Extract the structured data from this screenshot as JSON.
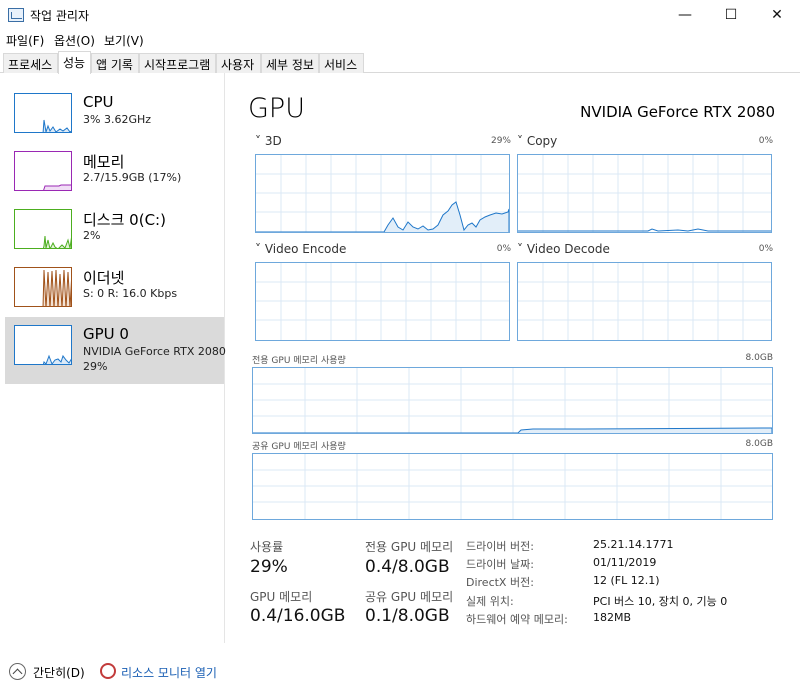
{
  "window": {
    "title": "작업 관리자",
    "controls": [
      "—",
      "☐",
      "✕"
    ]
  },
  "menu": [
    "파일(F)",
    "옵션(O)",
    "보기(V)"
  ],
  "tabs": [
    "프로세스",
    "성능",
    "앱 기록",
    "시작프로그램",
    "사용자",
    "세부 정보",
    "서비스"
  ],
  "active_tab": "성능",
  "sidebar": [
    {
      "title": "CPU",
      "sub1": "3% 3.62GHz",
      "sub2": "",
      "color": "#1f77c9"
    },
    {
      "title": "메모리",
      "sub1": "2.7/15.9GB (17%)",
      "sub2": "",
      "color": "#9a28b4"
    },
    {
      "title": "디스크 0(C:)",
      "sub1": "2%",
      "sub2": "",
      "color": "#4cae1f"
    },
    {
      "title": "이더넷",
      "sub1": "S: 0 R: 16.0 Kbps",
      "sub2": "",
      "color": "#a0521a"
    },
    {
      "title": "GPU 0",
      "sub1": "NVIDIA GeForce RTX 2080",
      "sub2": "29%",
      "color": "#1f77c9"
    }
  ],
  "main": {
    "title": "GPU",
    "device_name": "NVIDIA GeForce RTX 2080",
    "engines": [
      {
        "label": "3D",
        "pct": "29%"
      },
      {
        "label": "Copy",
        "pct": "0%"
      },
      {
        "label": "Video Encode",
        "pct": "0%"
      },
      {
        "label": "Video Decode",
        "pct": "0%"
      }
    ],
    "dedicated_label": "전용 GPU 메모리 사용량",
    "dedicated_max": "8.0GB",
    "shared_label": "공유 GPU 메모리 사용량",
    "shared_max": "8.0GB",
    "stats": {
      "usage_label": "사용률",
      "usage_value": "29%",
      "dedicated_label": "전용 GPU 메모리",
      "dedicated_value": "0.4/8.0GB",
      "gpu_mem_label": "GPU 메모리",
      "gpu_mem_value": "0.4/16.0GB",
      "shared_label": "공유 GPU 메모리",
      "shared_value": "0.1/8.0GB"
    },
    "info": [
      {
        "label": "드라이버 버전:",
        "value": "25.21.14.1771"
      },
      {
        "label": "드라이버 날짜:",
        "value": "01/11/2019"
      },
      {
        "label": "DirectX 버전:",
        "value": "12 (FL 12.1)"
      },
      {
        "label": "실제 위치:",
        "value": "PCI 버스 10, 장치 0, 기능 0"
      },
      {
        "label": "하드웨어 예약 메모리:",
        "value": "182MB"
      }
    ]
  },
  "footer": {
    "collapse_label": "간단히(D)",
    "monitor_label": "리소스 모니터 열기"
  },
  "colors": {
    "accent": "#1f77c9",
    "graph_border": "#6ea8dc",
    "link": "#1a5fb4"
  }
}
